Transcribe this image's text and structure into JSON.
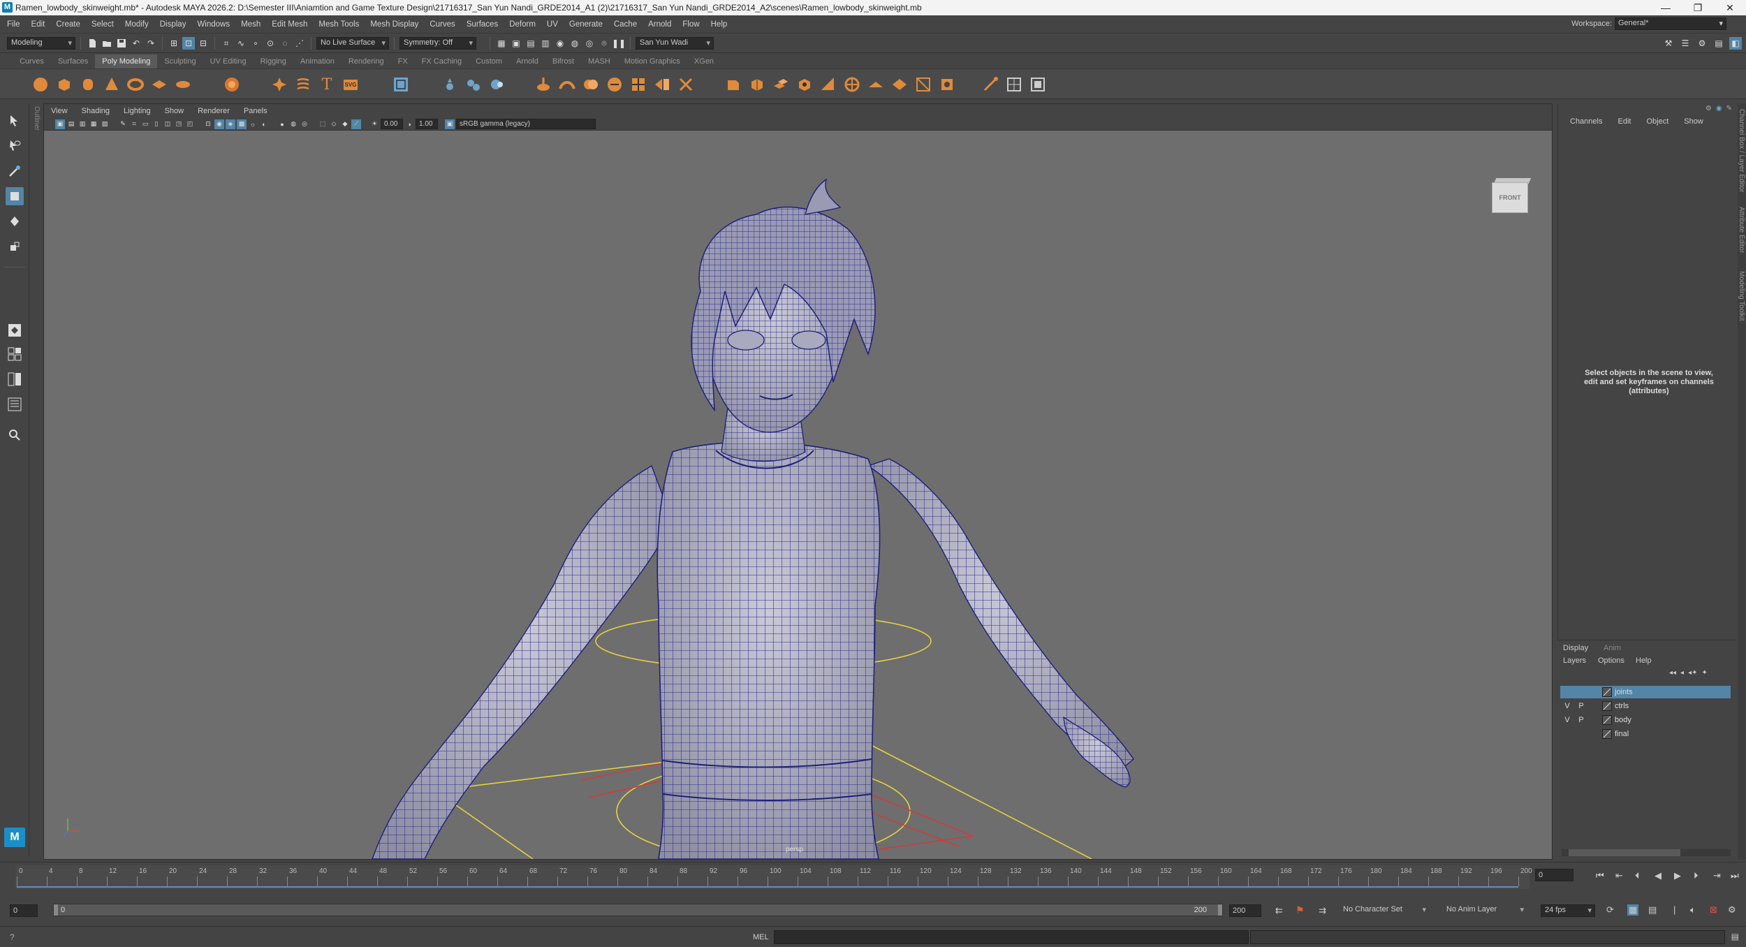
{
  "window": {
    "title": "Ramen_lowbody_skinweight.mb* - Autodesk MAYA 2026.2: D:\\Semester III\\Aniamtion and Game Texture Design\\21716317_San Yun Nandi_GRDE2014_A1 (2)\\21716317_San Yun Nandi_GRDE2014_A2\\scenes\\Ramen_lowbody_skinweight.mb",
    "app_icon": "maya-logo-icon",
    "minimize": "—",
    "maximize": "❐",
    "close": "✕"
  },
  "menus": [
    "File",
    "Edit",
    "Create",
    "Select",
    "Modify",
    "Display",
    "Windows",
    "Mesh",
    "Edit Mesh",
    "Mesh Tools",
    "Mesh Display",
    "Curves",
    "Surfaces",
    "Deform",
    "UV",
    "Generate",
    "Cache",
    "Arnold",
    "Flow",
    "Help"
  ],
  "workspace": {
    "label": "Workspace:",
    "value": "General*"
  },
  "statusline": {
    "menuset": "Modeling",
    "live_surface": "No Live Surface",
    "symmetry": "Symmetry: Off",
    "user": "San Yun Wadi"
  },
  "shelf_tabs": [
    "Curves",
    "Surfaces",
    "Poly Modeling",
    "Sculpting",
    "UV Editing",
    "Rigging",
    "Animation",
    "Rendering",
    "FX",
    "FX Caching",
    "Custom",
    "Arnold",
    "Bifrost",
    "MASH",
    "Motion Graphics",
    "XGen"
  ],
  "shelf_active": "Poly Modeling",
  "panel_menus": [
    "View",
    "Shading",
    "Lighting",
    "Show",
    "Renderer",
    "Panels"
  ],
  "panel_toolbar": {
    "exposure": "0.00",
    "gamma": "1.00",
    "colorspace": "sRGB gamma (legacy)"
  },
  "viewport": {
    "camera_label": "persp",
    "viewcube_label": "FRONT",
    "outliner_tab": "Outliner"
  },
  "channel_box": {
    "tabs": [
      "Channels",
      "Edit",
      "Object",
      "Show"
    ],
    "message": "Select objects in the scene to view, edit and set keyframes on channels (attributes)"
  },
  "side_tabs": [
    "Channel Box / Layer Editor",
    "Attribute Editor",
    "Modeling Toolkit"
  ],
  "layer_editor": {
    "tabs": [
      "Display",
      "Anim"
    ],
    "menus": [
      "Layers",
      "Options",
      "Help"
    ],
    "layers": [
      {
        "v": "",
        "p": "",
        "name": "joints",
        "selected": true
      },
      {
        "v": "V",
        "p": "P",
        "name": "ctrls",
        "selected": false
      },
      {
        "v": "V",
        "p": "P",
        "name": "body",
        "selected": false
      },
      {
        "v": "",
        "p": "",
        "name": "final",
        "selected": false
      }
    ]
  },
  "time_slider": {
    "labels": [
      "0",
      "4",
      "8",
      "12",
      "16",
      "20",
      "24",
      "28",
      "32",
      "36",
      "40",
      "44",
      "48",
      "52",
      "56",
      "60",
      "64",
      "68",
      "72",
      "76",
      "80",
      "84",
      "88",
      "92",
      "96",
      "100",
      "104",
      "108",
      "112",
      "116",
      "120",
      "124",
      "128",
      "132",
      "136",
      "140",
      "144",
      "148",
      "152",
      "156",
      "160",
      "164",
      "168",
      "172",
      "176",
      "180",
      "184",
      "188",
      "192",
      "196",
      "200"
    ],
    "current_frame": "0"
  },
  "range_slider": {
    "start": "0",
    "inner_start": "0",
    "inner_end": "200",
    "end": "200",
    "character_set": "No Character Set",
    "anim_layer": "No Anim Layer",
    "fps": "24 fps"
  },
  "command_line": {
    "label": "MEL"
  }
}
